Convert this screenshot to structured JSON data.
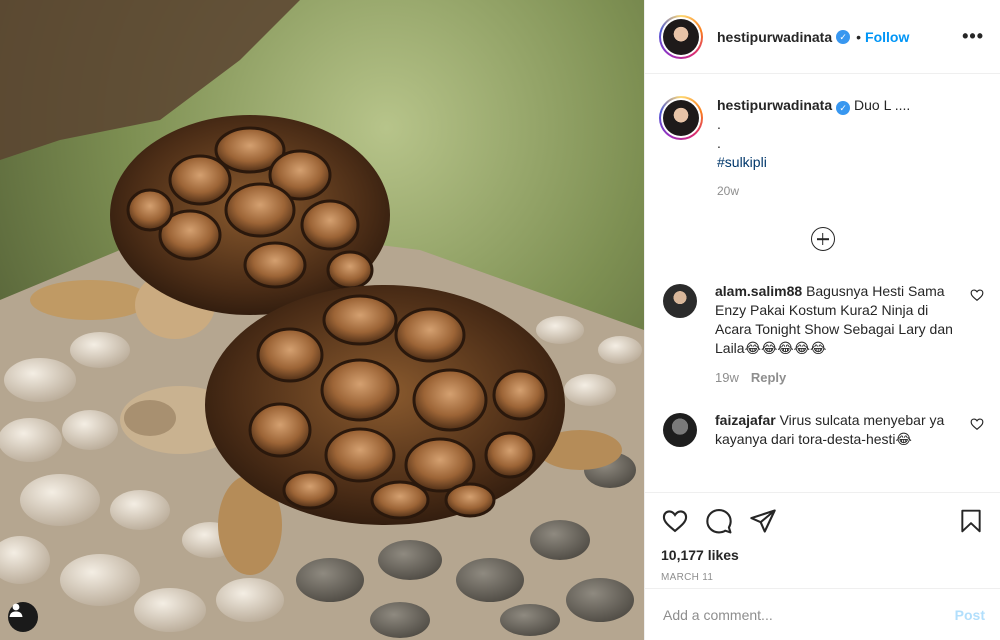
{
  "photo": {
    "subject": "two tortoises on pebbles and grass",
    "user_tag_icon": "user-icon"
  },
  "header": {
    "username": "hestipurwadinata",
    "verified_icon": "verified-badge-icon",
    "separator": "•",
    "follow_label": "Follow",
    "more_icon": "more-options-icon",
    "more_label": "•••"
  },
  "caption": {
    "username": "hestipurwadinata",
    "text": "Duo L ....",
    "line2": ".",
    "line3": ".",
    "hashtag": "#sulkipli",
    "age": "20w"
  },
  "load_more_icon": "plus-circle-icon",
  "comments": [
    {
      "username": "alam.salim88",
      "text": "Bagusnya Hesti Sama Enzy Pakai Kostum Kura2 Ninja di Acara Tonight Show Sebagai Lary dan Laila😂😂😂😂😂",
      "age": "19w",
      "reply_label": "Reply"
    },
    {
      "username": "faizajafar",
      "text": "Virus sulcata menyebar ya kayanya dari tora-desta-hesti😂"
    }
  ],
  "actions": {
    "like_icon": "heart-icon",
    "comment_icon": "comment-icon",
    "share_icon": "paper-plane-icon",
    "save_icon": "bookmark-icon",
    "likes_text": "10,177 likes",
    "date": "MARCH 11"
  },
  "add_comment": {
    "placeholder": "Add a comment...",
    "post_label": "Post"
  },
  "colors": {
    "accent": "#0095f6",
    "verified": "#3897f0",
    "muted": "#8e8e8e",
    "post_disabled": "#b2dffc"
  }
}
